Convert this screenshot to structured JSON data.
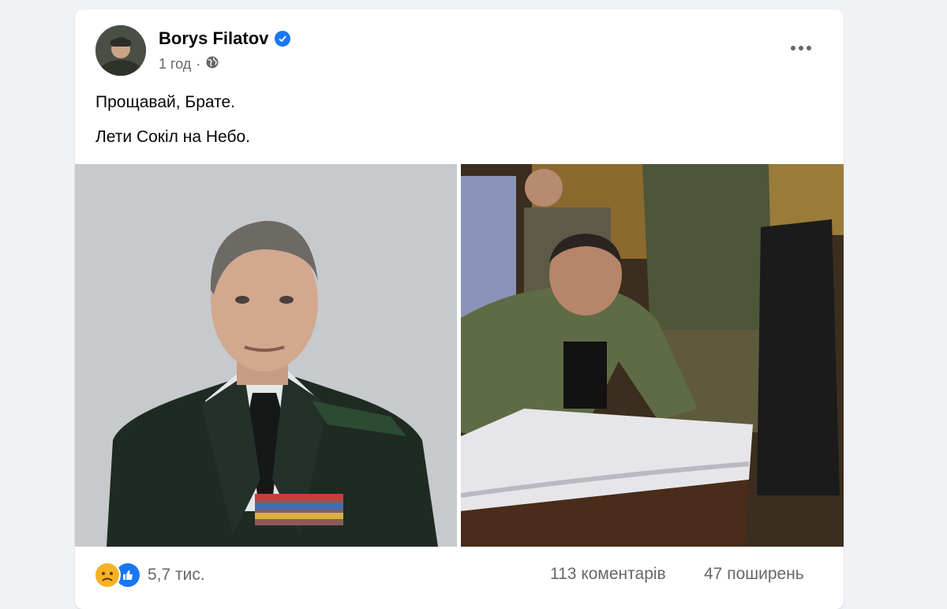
{
  "post": {
    "author": "Borys Filatov",
    "time": "1 год",
    "audience_icon": "globe-icon",
    "verified_icon": "verified-badge-icon",
    "menu_icon": "more-options-icon",
    "text_lines": [
      "Прощавай, Брате.",
      "Лети Сокіл на Небо."
    ]
  },
  "photos": [
    {
      "name": "officer-portrait-photo"
    },
    {
      "name": "funeral-ceremony-photo"
    }
  ],
  "footer": {
    "reaction_icons": [
      "sad-reaction-icon",
      "like-reaction-icon"
    ],
    "reaction_count": "5,7 тис.",
    "comments": "113 коментарів",
    "shares": "47 поширень"
  },
  "colors": {
    "background": "#f0f2f5",
    "card": "#ffffff",
    "accent": "#1877f2",
    "secondary_text": "#65676b"
  }
}
